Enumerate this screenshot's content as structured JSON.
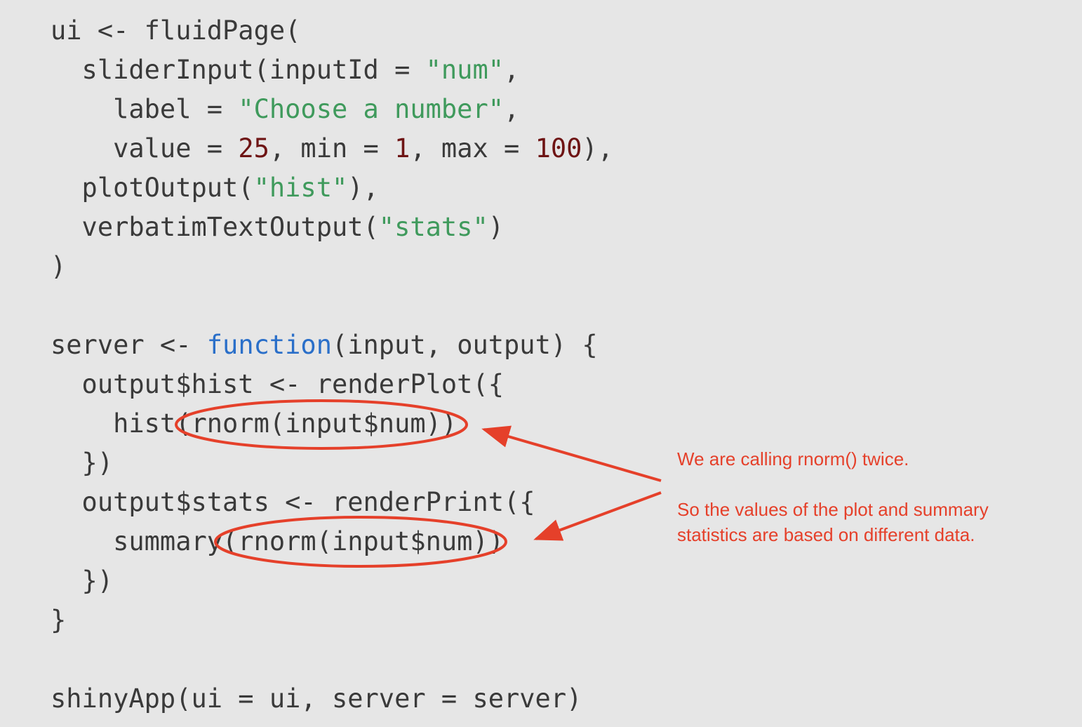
{
  "code": {
    "lines": [
      [
        {
          "t": "ui <- fluidPage("
        }
      ],
      [
        {
          "t": "  sliderInput(inputId = "
        },
        {
          "t": "\"num\"",
          "c": "str"
        },
        {
          "t": ","
        }
      ],
      [
        {
          "t": "    label = "
        },
        {
          "t": "\"Choose a number\"",
          "c": "str"
        },
        {
          "t": ","
        }
      ],
      [
        {
          "t": "    value = "
        },
        {
          "t": "25",
          "c": "num"
        },
        {
          "t": ", min = "
        },
        {
          "t": "1",
          "c": "num"
        },
        {
          "t": ", max = "
        },
        {
          "t": "100",
          "c": "num"
        },
        {
          "t": "),"
        }
      ],
      [
        {
          "t": "  plotOutput("
        },
        {
          "t": "\"hist\"",
          "c": "str"
        },
        {
          "t": "),"
        }
      ],
      [
        {
          "t": "  verbatimTextOutput("
        },
        {
          "t": "\"stats\"",
          "c": "str"
        },
        {
          "t": ")"
        }
      ],
      [
        {
          "t": ")"
        }
      ],
      [],
      [
        {
          "t": "server <- "
        },
        {
          "t": "function",
          "c": "kw"
        },
        {
          "t": "(input, output) {"
        }
      ],
      [
        {
          "t": "  output$hist <- renderPlot({"
        }
      ],
      [
        {
          "t": "    hist(rnorm(input$num))"
        }
      ],
      [
        {
          "t": "  })"
        }
      ],
      [
        {
          "t": "  output$stats <- renderPrint({"
        }
      ],
      [
        {
          "t": "    summary(rnorm(input$num))"
        }
      ],
      [
        {
          "t": "  })"
        }
      ],
      [
        {
          "t": "}"
        }
      ],
      [],
      [
        {
          "t": "shinyApp(ui = ui, server = server)"
        }
      ]
    ]
  },
  "annotation": {
    "note1": "We are calling rnorm() twice.",
    "note2": "So the values of the plot and summary\nstatistics are based on different data.",
    "color": "#e5402a"
  }
}
